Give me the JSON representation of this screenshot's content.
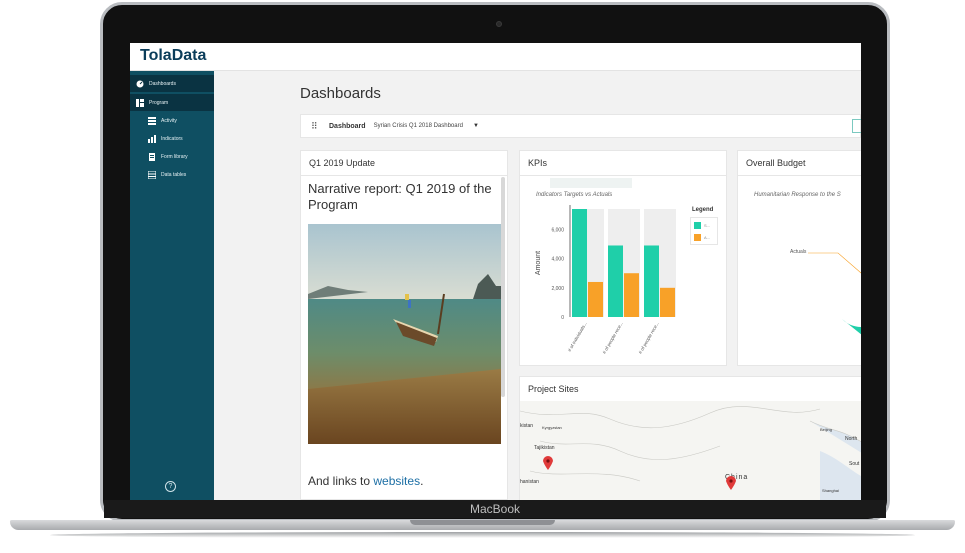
{
  "device": {
    "label": "MacBook"
  },
  "app": {
    "logo": "TolaData"
  },
  "sidebar": {
    "items": [
      {
        "label": "Dashboards",
        "icon": "dashboard-icon"
      },
      {
        "label": "Program",
        "icon": "program-icon"
      },
      {
        "label": "Activity",
        "icon": "list-icon"
      },
      {
        "label": "Indicators",
        "icon": "bar-chart-icon"
      },
      {
        "label": "Form library",
        "icon": "form-icon"
      },
      {
        "label": "Data tables",
        "icon": "table-icon"
      }
    ],
    "help": "?"
  },
  "page": {
    "title": "Dashboards"
  },
  "toolbar": {
    "label": "Dashboard",
    "selected_dashboard": "Syrian Crisis Q1 2018 Dashboard"
  },
  "panels": {
    "update": {
      "title": "Q1 2019 Update",
      "heading": "Narrative report: Q1 2019 of the Program",
      "links_text": "And links to ",
      "links_link": "websites",
      "links_end": "."
    },
    "kpis": {
      "title": "KPIs"
    },
    "budget": {
      "title": "Overall Budget",
      "subtitle": "Humanitarian Response to the S",
      "actuals_label": "Actuals"
    },
    "sites": {
      "title": "Project Sites",
      "map_labels": [
        "kistan",
        "Kyrgyzstan",
        "Tajikistan",
        "hanistan",
        "China",
        "Beijing",
        "North",
        "Sout",
        "Shanghai"
      ]
    }
  },
  "colors": {
    "teal": "#1fcfa9",
    "orange": "#f8a128",
    "sidebar": "#0f4f62",
    "ghost": "#eeeeee"
  },
  "chart_data": {
    "type": "bar",
    "title": "Indicators Targets vs Actuals",
    "ylabel": "Amount",
    "categories": [
      "# of individuals...",
      "# of people rece...",
      "# of people rece..."
    ],
    "series": [
      {
        "values": [
          7400,
          4900,
          4900
        ]
      },
      {
        "values": [
          2400,
          3000,
          2000
        ]
      }
    ],
    "background_values": [
      7400,
      7400,
      7400
    ],
    "yticks": [
      "0",
      "2,000",
      "4,000",
      "6,000"
    ],
    "ylim": [
      0,
      7400
    ],
    "legend": {
      "title": "Legend",
      "entries": [
        "S...",
        "A..."
      ]
    }
  }
}
